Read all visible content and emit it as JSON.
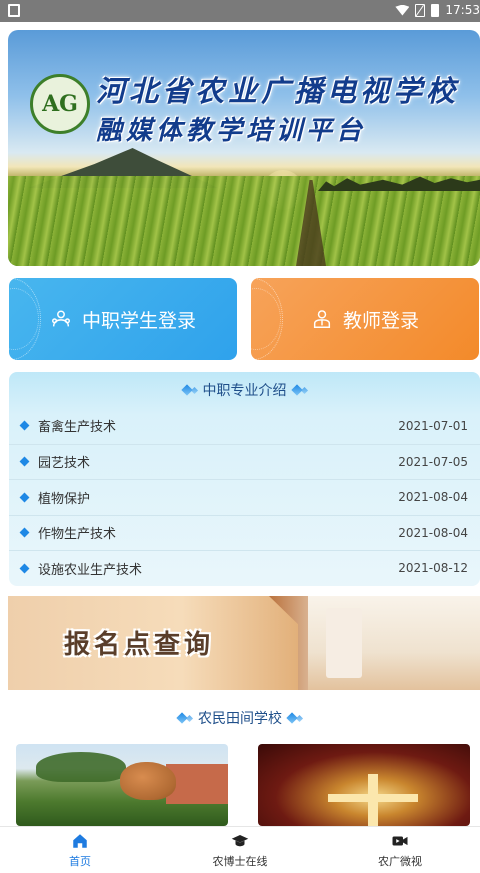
{
  "status_bar": {
    "time": "17:53"
  },
  "banner": {
    "title_line1": "河北省农业广播电视学校",
    "title_line2": "融媒体教学培训平台",
    "logo_text": "AG"
  },
  "login": {
    "student_label": "中职学生登录",
    "teacher_label": "教师登录"
  },
  "major_intro": {
    "title": "中职专业介绍",
    "items": [
      {
        "name": "畜禽生产技术",
        "date": "2021-07-01"
      },
      {
        "name": "园艺技术",
        "date": "2021-07-05"
      },
      {
        "name": "植物保护",
        "date": "2021-08-04"
      },
      {
        "name": "作物生产技术",
        "date": "2021-08-04"
      },
      {
        "name": "设施农业生产技术",
        "date": "2021-08-12"
      }
    ]
  },
  "registration_banner": {
    "text": "报名点查询"
  },
  "field_school": {
    "title": "农民田间学校"
  },
  "bottom_nav": {
    "items": [
      {
        "label": "首页",
        "icon": "home-icon",
        "active": true
      },
      {
        "label": "农博士在线",
        "icon": "graduation-cap-icon",
        "active": false
      },
      {
        "label": "农广微视",
        "icon": "video-camera-icon",
        "active": false
      }
    ],
    "active_color": "#1e7be0"
  },
  "colors": {
    "student_button": "#2fa2ec",
    "teacher_button": "#f38a2a",
    "section_title": "#1f4f8a"
  }
}
